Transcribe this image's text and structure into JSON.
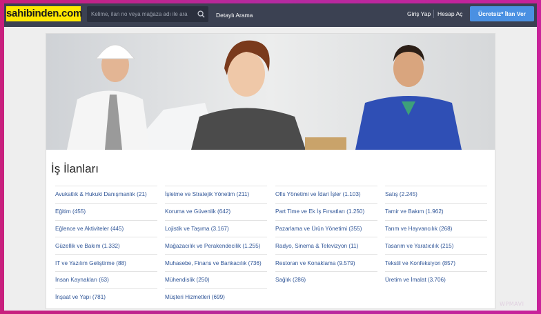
{
  "header": {
    "logo": "sahibinden.com",
    "search_placeholder": "Kelime, ilan no veya mağaza adı ile ara",
    "detailed_search": "Detaylı Arama",
    "login": "Giriş Yap",
    "register": "Hesap Aç",
    "post_ad": "Ücretsiz* İlan Ver"
  },
  "page": {
    "title": "İş İlanları"
  },
  "categories": {
    "col1": [
      "Avukatlık & Hukuki Danışmanlık (21)",
      "Eğitim (455)",
      "Eğlence ve Aktiviteler (445)",
      "Güzellik ve Bakım (1.332)",
      "IT ve Yazılım Geliştirme (88)",
      "İnsan Kaynakları (63)",
      "İnşaat ve Yapı (781)"
    ],
    "col2": [
      "İşletme ve Stratejik Yönetim (211)",
      "Koruma ve Güvenlik (642)",
      "Lojistik ve Taşıma (3.167)",
      "Mağazacılık ve Perakendecilik (1.255)",
      "Muhasebe, Finans ve Bankacılık (736)",
      "Mühendislik (250)",
      "Müşteri Hizmetleri (699)"
    ],
    "col3": [
      "Ofis Yönetimi ve İdari İşler (1.103)",
      "Part Time ve Ek İş Fırsatları (1.250)",
      "Pazarlama ve Ürün Yönetimi (355)",
      "Radyo, Sinema & Televizyon (11)",
      "Restoran ve Konaklama (9.579)",
      "Sağlık (286)"
    ],
    "col4": [
      "Satış (2.245)",
      "Tamir ve Bakım (1.962)",
      "Tarım ve Hayvancılık (268)",
      "Tasarım ve Yaratıcılık (215)",
      "Tekstil ve Konfeksiyon (857)",
      "Üretim ve İmalat (3.706)"
    ]
  },
  "watermark": "WPMAVI",
  "colors": {
    "header_bg": "#3b4152",
    "logo_bg": "#ffe800",
    "post_button": "#4a90e2",
    "link": "#2f5597"
  }
}
